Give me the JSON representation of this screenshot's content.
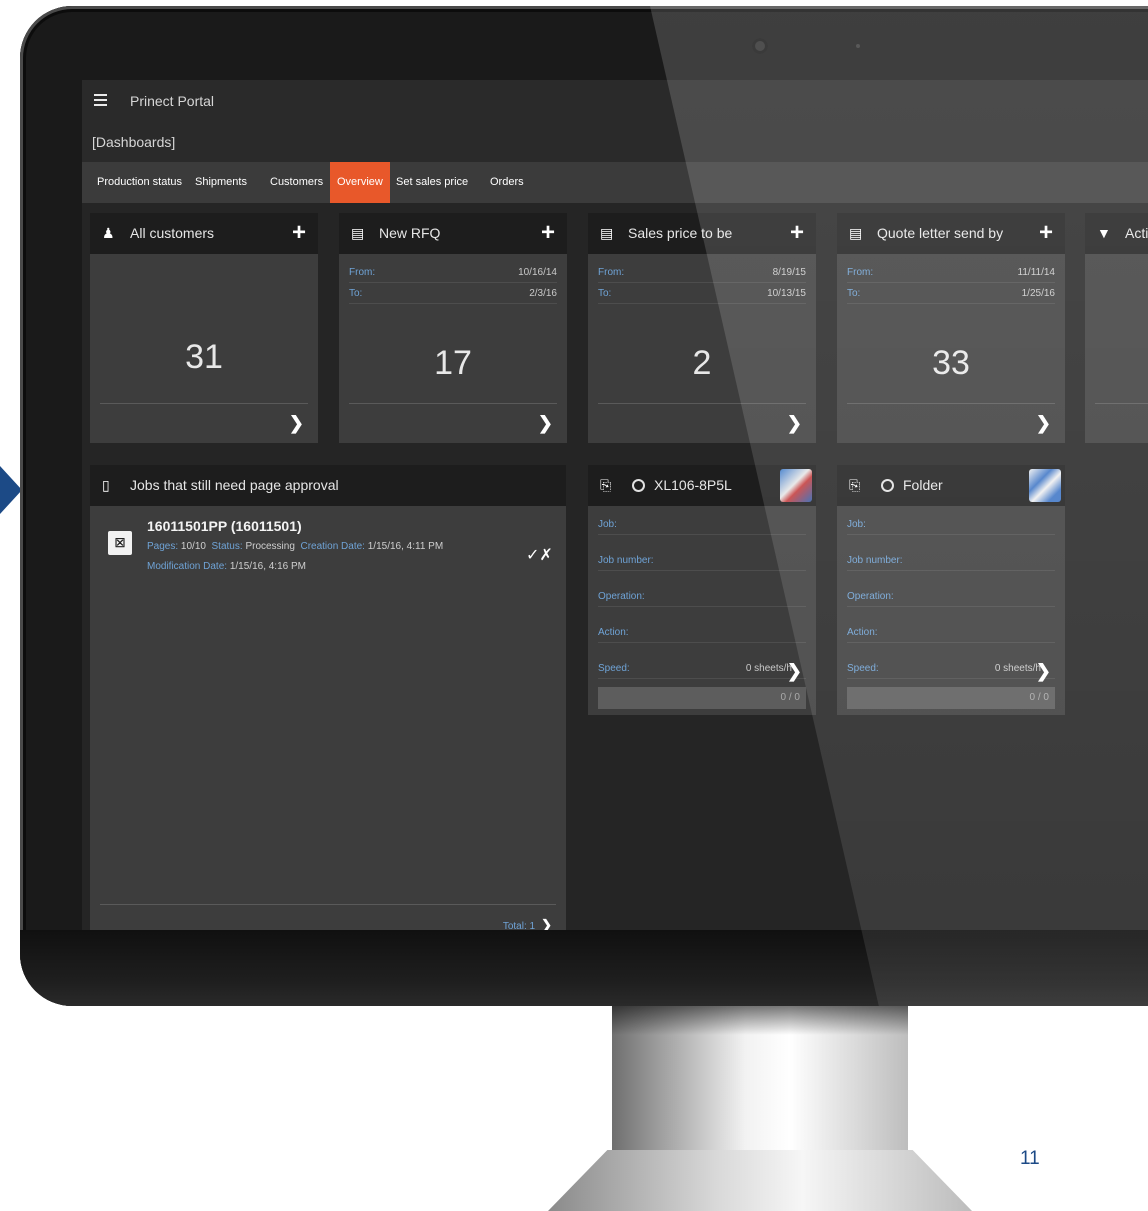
{
  "app": {
    "title": "Prinect Portal",
    "breadcrumb": "[Dashboards]"
  },
  "tabs": [
    {
      "label": "Production status",
      "active": false
    },
    {
      "label": "Shipments",
      "active": false
    },
    {
      "label": "Customers",
      "active": false
    },
    {
      "label": "Overview",
      "active": true
    },
    {
      "label": "Set sales price",
      "active": false
    },
    {
      "label": "Orders",
      "active": false
    }
  ],
  "cards": [
    {
      "title": "All customers",
      "icon": "person-icon",
      "count": "31"
    },
    {
      "title": "New RFQ",
      "icon": "message-icon",
      "from_label": "From:",
      "from": "10/16/14",
      "to_label": "To:",
      "to": "2/3/16",
      "count": "17"
    },
    {
      "title": "Sales price to be",
      "icon": "message-icon",
      "from_label": "From:",
      "from": "8/19/15",
      "to_label": "To:",
      "to": "10/13/15",
      "count": "2"
    },
    {
      "title": "Quote letter send by",
      "icon": "message-icon",
      "from_label": "From:",
      "from": "11/11/14",
      "to_label": "To:",
      "to": "1/25/16",
      "count": "33"
    },
    {
      "title": "Acti",
      "icon": "basket-icon"
    }
  ],
  "jobs": {
    "title": "Jobs that still need page approval",
    "item": {
      "title": "16011501PP (16011501)",
      "pages_label": "Pages:",
      "pages": "10/10",
      "status_label": "Status:",
      "status": "Processing",
      "created_label": "Creation Date:",
      "created": "1/15/16, 4:11 PM",
      "modified_label": "Modification Date:",
      "modified": "1/15/16, 4:16 PM"
    },
    "total": "Total: 1"
  },
  "machines": [
    {
      "title": "XL106-8P5L",
      "job_label": "Job:",
      "job_number_label": "Job number:",
      "operation_label": "Operation:",
      "action_label": "Action:",
      "speed_label": "Speed:",
      "speed": "0 sheets/h",
      "progress_text": "0 / 0",
      "progress": 0
    },
    {
      "title": "Folder",
      "job_label": "Job:",
      "job_number_label": "Job number:",
      "operation_label": "Operation:",
      "action_label": "Action:",
      "speed_label": "Speed:",
      "speed": "0 sheets/h",
      "progress_text": "0 / 0",
      "progress": 0
    }
  ],
  "page_number": "11",
  "colors": {
    "accent": "#e8582a",
    "link_blue": "#6fa3d6",
    "brand_blue": "#1c4a86"
  }
}
